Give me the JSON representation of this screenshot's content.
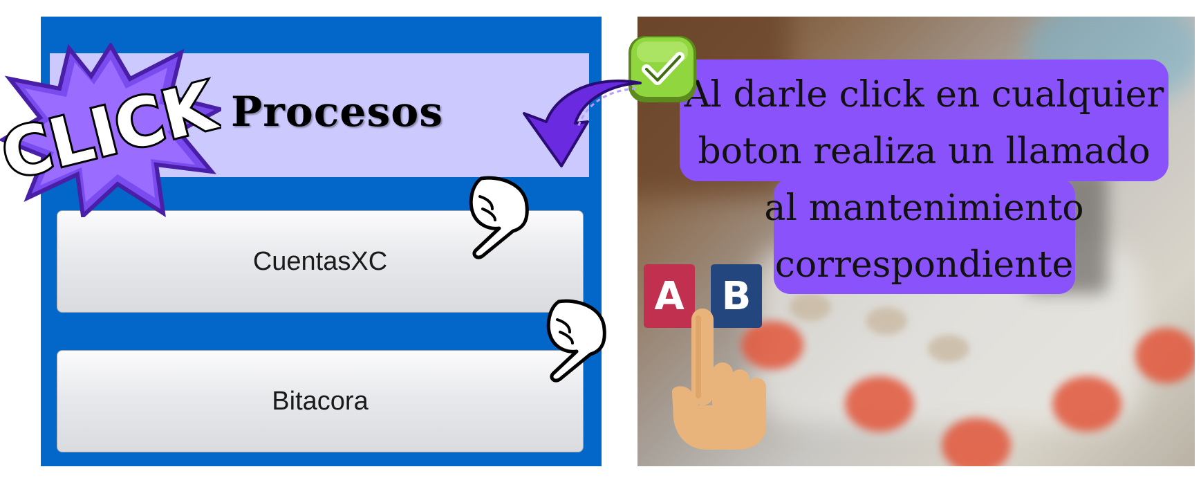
{
  "left_panel": {
    "header": {
      "title": "Procesos"
    },
    "buttons": [
      {
        "label": "CuentasXC"
      },
      {
        "label": "Bitacora"
      }
    ],
    "click_badge": {
      "text": "CLICK"
    }
  },
  "right_panel": {
    "callout": {
      "text": "Al darle click en cualquier boton realiza un llamado al mantenimiento correspondiente"
    },
    "keys": [
      {
        "label": "A",
        "color": "#c2304f"
      },
      {
        "label": "B",
        "color": "#23467e"
      }
    ]
  },
  "colors": {
    "panel_blue": "#0267c9",
    "header_lavender": "#cbc9fd",
    "callout_purple": "#8a52fb",
    "arrow_purple": "#6a2be0",
    "check_green": "#8fd63f"
  },
  "icons": [
    "click-burst-icon",
    "curved-arrow-icon",
    "checkmark-icon",
    "pointing-hand-icon",
    "hand-finger-icon"
  ]
}
